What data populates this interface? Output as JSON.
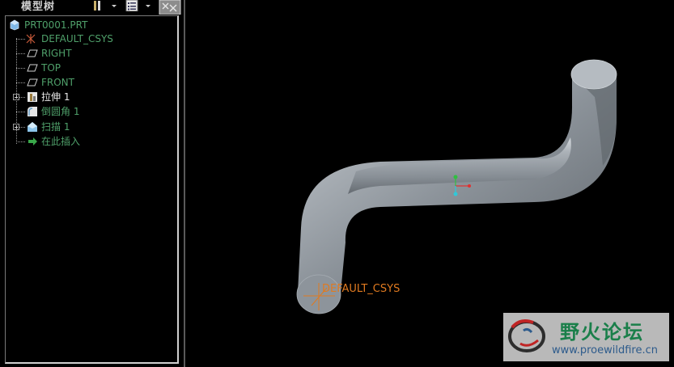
{
  "model_tree": {
    "title": "模型树",
    "items": [
      {
        "label": "PRT0001.PRT",
        "icon": "part-icon",
        "style": "dim"
      },
      {
        "label": "DEFAULT_CSYS",
        "icon": "csys-icon",
        "style": "dim"
      },
      {
        "label": "RIGHT",
        "icon": "datum-plane-icon",
        "style": "dim"
      },
      {
        "label": "TOP",
        "icon": "datum-plane-icon",
        "style": "dim"
      },
      {
        "label": "FRONT",
        "icon": "datum-plane-icon",
        "style": "dim"
      },
      {
        "label": "拉伸 1",
        "icon": "extrude-icon",
        "style": "white",
        "expandable": true
      },
      {
        "label": "倒圆角 1",
        "icon": "round-icon",
        "style": "dim"
      },
      {
        "label": "扫描 1",
        "icon": "sweep-icon",
        "style": "dim",
        "expandable": true
      },
      {
        "label": "在此插入",
        "icon": "insert-here-icon",
        "style": "dim"
      }
    ]
  },
  "viewport": {
    "csys_label": "DEFAULT_CSYS"
  },
  "watermark": {
    "title": "野火论坛",
    "url": "www.proewildfire.cn"
  },
  "colors": {
    "background": "#000000",
    "tree_text_dim": "#4fa06a",
    "csys_label": "#e07a20",
    "pipe": "#8e959c"
  }
}
